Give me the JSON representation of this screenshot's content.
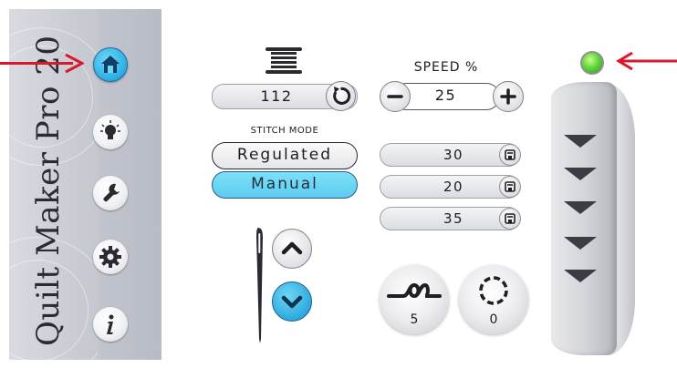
{
  "sidebar": {
    "brand_title": "Quilt Maker Pro 20",
    "nav": [
      {
        "id": "home",
        "icon": "home-icon",
        "active": true
      },
      {
        "id": "tips",
        "icon": "lightbulb-icon",
        "active": false
      },
      {
        "id": "tools",
        "icon": "wrench-icon",
        "active": false
      },
      {
        "id": "settings",
        "icon": "gear-icon",
        "active": false
      },
      {
        "id": "info",
        "icon": "info-icon",
        "active": false
      }
    ]
  },
  "bobbin": {
    "icon": "spool-icon",
    "count": "112",
    "reset_icon": "reset-icon"
  },
  "stitch_mode": {
    "label": "STITCH MODE",
    "options": [
      "Regulated",
      "Manual"
    ],
    "selected": "Manual"
  },
  "needle": {
    "icon": "needle-icon",
    "up_icon": "chevron-up-icon",
    "down_icon": "chevron-down-icon",
    "selected": "down"
  },
  "speed": {
    "label": "SPEED %",
    "value": "25",
    "minus_icon": "minus-icon",
    "plus_icon": "plus-icon"
  },
  "presets": [
    {
      "value": "30",
      "icon": "save-icon"
    },
    {
      "value": "20",
      "icon": "save-icon"
    },
    {
      "value": "35",
      "icon": "save-icon"
    }
  ],
  "tie_off": {
    "icon": "knot-icon",
    "value": "5"
  },
  "stitch_counter": {
    "icon": "dashed-circle-icon",
    "value": "0"
  },
  "status_led": {
    "color": "#5fd83a"
  },
  "colors": {
    "accent": "#33b4e8",
    "manual_highlight": "#6fd8f6",
    "annotation_arrow": "#d8192b"
  }
}
